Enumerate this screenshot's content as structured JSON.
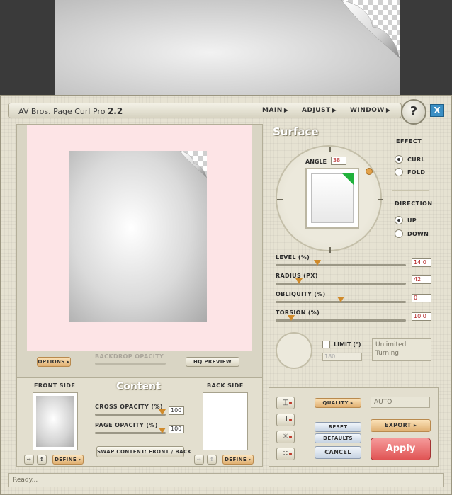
{
  "title": {
    "app": "AV Bros. Page Curl Pro",
    "version": "2.2"
  },
  "menus": [
    "MAIN",
    "ADJUST",
    "WINDOW"
  ],
  "help_label": "?",
  "close_label": "X",
  "preview": {
    "options_label": "OPTIONS",
    "backdrop_opacity_label": "BACKDROP OPACITY",
    "hq_preview_label": "HQ PREVIEW"
  },
  "surface": {
    "title": "Surface",
    "angle_label": "ANGLE",
    "angle_value": "38",
    "effect": {
      "label": "EFFECT",
      "options": [
        "CURL",
        "FOLD"
      ],
      "selected": "CURL"
    },
    "direction": {
      "label": "DIRECTION",
      "options": [
        "UP",
        "DOWN"
      ],
      "selected": "UP"
    },
    "params": [
      {
        "label": "LEVEL (%)",
        "value": "14.0",
        "fraction": 0.32
      },
      {
        "label": "RADIUS (PX)",
        "value": "42",
        "fraction": 0.18
      },
      {
        "label": "OBLIQUITY (%)",
        "value": "0",
        "fraction": 0.5
      },
      {
        "label": "TORSION (%)",
        "value": "10.0",
        "fraction": 0.12
      }
    ],
    "limit_label": "LIMIT (°)",
    "limit_value": "180",
    "limit_text": "Unlimited Turning"
  },
  "content": {
    "title": "Content",
    "front_side_label": "FRONT SIDE",
    "back_side_label": "BACK SIDE",
    "cross_opacity_label": "CROSS OPACITY (%)",
    "cross_opacity_value": "100",
    "page_opacity_label": "PAGE OPACITY (%)",
    "page_opacity_value": "100",
    "swap_label": "SWAP CONTENT: FRONT / BACK",
    "define_label": "DEFINE"
  },
  "actions": {
    "quality_label": "QUALITY",
    "quality_value": "AUTO",
    "reset_label": "RESET",
    "defaults_label": "DEFAULTS",
    "cancel_label": "CANCEL",
    "export_label": "EXPORT",
    "apply_label": "Apply"
  },
  "status": "Ready..."
}
